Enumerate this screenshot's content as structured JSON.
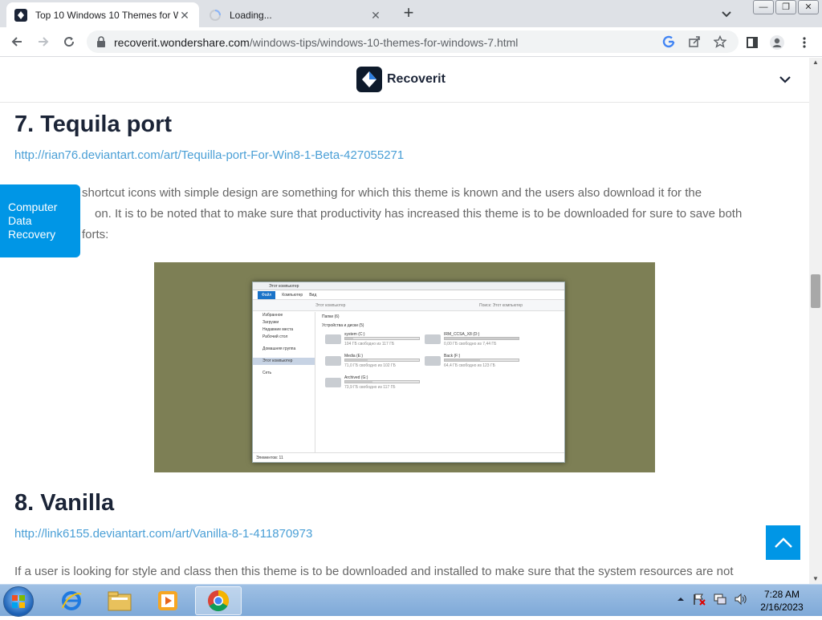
{
  "browser": {
    "tabs": [
      {
        "title": "Top 10 Windows 10 Themes for W",
        "active": true
      },
      {
        "title": "Loading...",
        "active": false
      }
    ],
    "new_tab_symbol": "+",
    "url_host": "recoverit.wondershare.com",
    "url_path": "/windows-tips/windows-10-themes-for-windows-7.html",
    "window_buttons": {
      "minimize": "—",
      "restore": "❐",
      "close": "✕"
    }
  },
  "site": {
    "brand": "Recoverit",
    "side_tab_label": "Computer Data Recovery"
  },
  "article": {
    "section7": {
      "heading": "7. Tequila port",
      "link": "http://rian76.deviantart.com/art/Tequilla-port-For-Win8-1-Beta-427055271",
      "lines": [
        "shortcut icons with simple design are something for which this theme is known and the users also download it for the",
        "on. It is to be noted that to make sure that productivity has increased this theme is to be downloaded for sure to save both",
        "forts:"
      ]
    },
    "section8": {
      "heading": "8. Vanilla",
      "link": "http://link6155.deviantart.com/art/Vanilla-8-1-411870973",
      "lines": [
        "If a user is looking for style and class then this theme is to be downloaded and installed to make sure that the system resources are not"
      ]
    }
  },
  "explorer_mock": {
    "title": "Этот компьютер",
    "ribbon": [
      "Файл",
      "Компьютер",
      "Вид"
    ],
    "address": "Этот компьютер",
    "search": "Поиск: Этот компьютер",
    "nav": [
      "Избранное",
      "Загрузки",
      "Недавние места",
      "Рабочий стол",
      "Домашняя группа",
      "Этот компьютер",
      "Сеть"
    ],
    "group_folders": "Папки (6)",
    "group_drives": "Устройства и диски (5)",
    "drives": [
      {
        "name": "system (C:)",
        "free": "104 ГБ свободно из 117 ГБ",
        "used": 0.11
      },
      {
        "name": "IRM_CCSA_X8 (D:)",
        "free": "0,00 ГБ свободно из 7,44 ГБ",
        "used": 1.0
      },
      {
        "name": "Media (E:)",
        "free": "71,0 ГБ свободно из 102 ГБ",
        "used": 0.3
      },
      {
        "name": "Back (F:)",
        "free": "64,4 ГБ свободно из 123 ГБ",
        "used": 0.48
      },
      {
        "name": "Archived (G:)",
        "free": "73,9 ГБ свободно из 117 ГБ",
        "used": 0.37
      }
    ],
    "status": "Элементов: 11"
  },
  "taskbar": {
    "time": "7:28 AM",
    "date": "2/16/2023"
  },
  "colors": {
    "accent": "#0096e6",
    "link": "#4a9fd6",
    "heading": "#1b2437"
  }
}
